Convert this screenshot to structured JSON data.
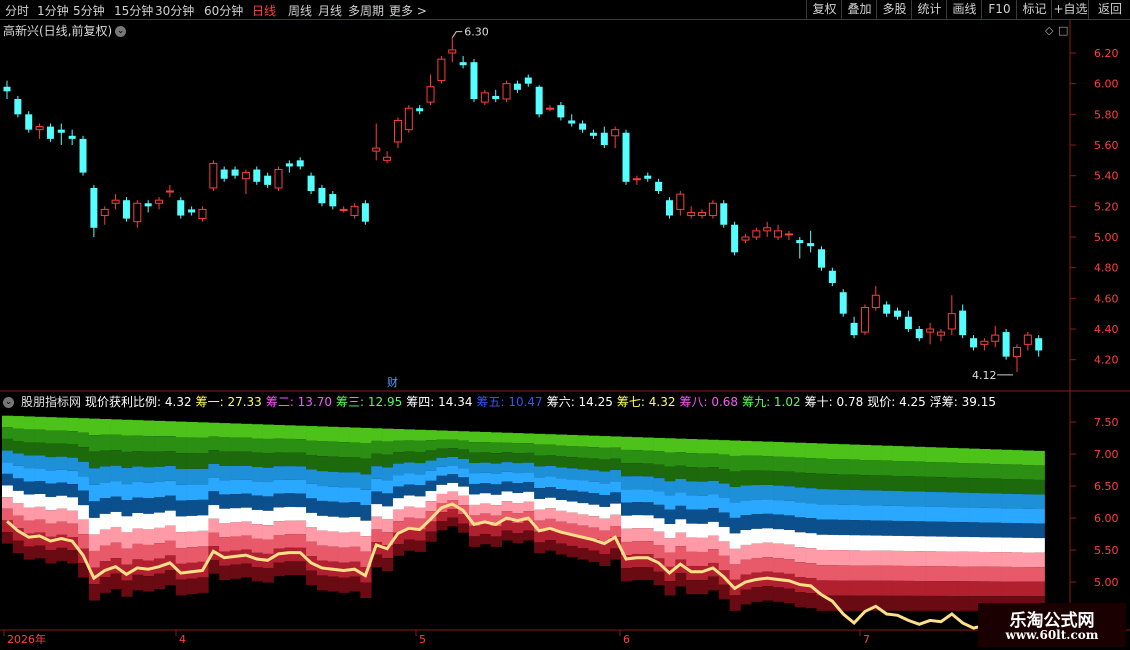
{
  "toolbar": {
    "periods": [
      "分时",
      "1分钟",
      "5分钟",
      "15分钟",
      "30分钟",
      "60分钟",
      "日线",
      "周线",
      "月线",
      "多周期",
      "更多 >"
    ],
    "active_period": "日线",
    "actions": [
      "复权",
      "叠加",
      "多股",
      "统计",
      "画线",
      "F10",
      "标记",
      "+自选",
      "返回"
    ]
  },
  "chart": {
    "title": "高新兴(日线,前复权)",
    "high_marker": "6.30",
    "low_marker": "4.12",
    "finance_marker": "财",
    "y_ticks": [
      "6.20",
      "6.00",
      "5.80",
      "5.60",
      "5.40",
      "5.20",
      "5.00",
      "4.80",
      "4.60",
      "4.40",
      "4.20"
    ],
    "up_color": "#ff3c3c",
    "down_color": "#54ffff"
  },
  "indicator": {
    "name": "股朋指标网",
    "fields": [
      {
        "label": "现价获利比例: 4.32",
        "color": "#ffffff"
      },
      {
        "label": "筹一: 27.33",
        "color": "#ffff55"
      },
      {
        "label": "筹二: 13.70",
        "color": "#ff55ff"
      },
      {
        "label": "筹三: 12.95",
        "color": "#55ff55"
      },
      {
        "label": "筹四: 14.34",
        "color": "#ffffff"
      },
      {
        "label": "筹五: 10.47",
        "color": "#3355ff"
      },
      {
        "label": "筹六: 14.25",
        "color": "#ffffff"
      },
      {
        "label": "筹七: 4.32",
        "color": "#ffff55"
      },
      {
        "label": "筹八: 0.68",
        "color": "#ff55ff"
      },
      {
        "label": "筹九: 1.02",
        "color": "#55ff55"
      },
      {
        "label": "筹十: 0.78",
        "color": "#ffffff"
      },
      {
        "label": "现价: 4.25",
        "color": "#ffffff"
      },
      {
        "label": "浮筹: 39.15",
        "color": "#ffffff"
      }
    ],
    "y_ticks": [
      "7.50",
      "7.00",
      "6.50",
      "6.00",
      "5.50",
      "5.00",
      "4.50"
    ]
  },
  "x_axis": {
    "labels": [
      "2026年",
      "4",
      "5",
      "6",
      "7"
    ]
  },
  "watermark": {
    "line1": "乐淘公式网",
    "line2": "www.60lt.com"
  },
  "chart_data": {
    "type": "candlestick",
    "title": "高新兴(日线,前复权)",
    "ylim": [
      4.1,
      6.35
    ],
    "x": [
      "2026年",
      "4",
      "5",
      "6",
      "7"
    ],
    "candles": [
      [
        5.98,
        6.02,
        5.9,
        5.95
      ],
      [
        5.9,
        5.92,
        5.78,
        5.8
      ],
      [
        5.8,
        5.82,
        5.68,
        5.7
      ],
      [
        5.7,
        5.74,
        5.64,
        5.72
      ],
      [
        5.72,
        5.74,
        5.62,
        5.64
      ],
      [
        5.7,
        5.74,
        5.6,
        5.68
      ],
      [
        5.66,
        5.7,
        5.6,
        5.64
      ],
      [
        5.64,
        5.66,
        5.4,
        5.42
      ],
      [
        5.32,
        5.34,
        5.0,
        5.06
      ],
      [
        5.14,
        5.2,
        5.08,
        5.18
      ],
      [
        5.22,
        5.28,
        5.18,
        5.24
      ],
      [
        5.24,
        5.26,
        5.1,
        5.12
      ],
      [
        5.1,
        5.24,
        5.06,
        5.22
      ],
      [
        5.22,
        5.24,
        5.16,
        5.2
      ],
      [
        5.22,
        5.26,
        5.18,
        5.24
      ],
      [
        5.3,
        5.34,
        5.26,
        5.3
      ],
      [
        5.24,
        5.26,
        5.12,
        5.14
      ],
      [
        5.18,
        5.2,
        5.14,
        5.16
      ],
      [
        5.12,
        5.2,
        5.1,
        5.18
      ],
      [
        5.32,
        5.5,
        5.3,
        5.48
      ],
      [
        5.44,
        5.46,
        5.36,
        5.38
      ],
      [
        5.44,
        5.46,
        5.38,
        5.4
      ],
      [
        5.38,
        5.44,
        5.28,
        5.42
      ],
      [
        5.44,
        5.46,
        5.34,
        5.36
      ],
      [
        5.4,
        5.42,
        5.32,
        5.34
      ],
      [
        5.32,
        5.46,
        5.3,
        5.44
      ],
      [
        5.48,
        5.5,
        5.42,
        5.46
      ],
      [
        5.5,
        5.52,
        5.44,
        5.46
      ],
      [
        5.4,
        5.42,
        5.28,
        5.3
      ],
      [
        5.32,
        5.34,
        5.2,
        5.22
      ],
      [
        5.28,
        5.3,
        5.18,
        5.2
      ],
      [
        5.18,
        5.2,
        5.16,
        5.18
      ],
      [
        5.14,
        5.22,
        5.12,
        5.2
      ],
      [
        5.22,
        5.24,
        5.08,
        5.1
      ],
      [
        5.56,
        5.74,
        5.5,
        5.58
      ],
      [
        5.5,
        5.56,
        5.48,
        5.52
      ],
      [
        5.62,
        5.78,
        5.58,
        5.76
      ],
      [
        5.7,
        5.86,
        5.68,
        5.84
      ],
      [
        5.84,
        5.86,
        5.8,
        5.82
      ],
      [
        5.88,
        6.06,
        5.86,
        5.98
      ],
      [
        6.02,
        6.18,
        6.0,
        6.16
      ],
      [
        6.2,
        6.3,
        6.14,
        6.22
      ],
      [
        6.14,
        6.18,
        6.1,
        6.12
      ],
      [
        6.14,
        6.16,
        5.88,
        5.9
      ],
      [
        5.88,
        5.96,
        5.86,
        5.94
      ],
      [
        5.92,
        5.96,
        5.88,
        5.9
      ],
      [
        5.9,
        6.02,
        5.88,
        6.0
      ],
      [
        6.0,
        6.02,
        5.94,
        5.96
      ],
      [
        6.04,
        6.06,
        5.98,
        6.0
      ],
      [
        5.98,
        5.99,
        5.78,
        5.8
      ],
      [
        5.84,
        5.86,
        5.82,
        5.84
      ],
      [
        5.86,
        5.88,
        5.76,
        5.78
      ],
      [
        5.76,
        5.8,
        5.72,
        5.74
      ],
      [
        5.74,
        5.76,
        5.68,
        5.7
      ],
      [
        5.68,
        5.7,
        5.64,
        5.66
      ],
      [
        5.68,
        5.72,
        5.58,
        5.6
      ],
      [
        5.66,
        5.72,
        5.58,
        5.7
      ],
      [
        5.68,
        5.7,
        5.34,
        5.36
      ],
      [
        5.38,
        5.4,
        5.34,
        5.38
      ],
      [
        5.4,
        5.42,
        5.36,
        5.38
      ],
      [
        5.36,
        5.38,
        5.28,
        5.3
      ],
      [
        5.24,
        5.26,
        5.12,
        5.14
      ],
      [
        5.18,
        5.3,
        5.14,
        5.28
      ],
      [
        5.14,
        5.2,
        5.12,
        5.16
      ],
      [
        5.14,
        5.18,
        5.12,
        5.16
      ],
      [
        5.14,
        5.24,
        5.12,
        5.22
      ],
      [
        5.22,
        5.24,
        5.06,
        5.08
      ],
      [
        5.08,
        5.1,
        4.88,
        4.9
      ],
      [
        4.98,
        5.02,
        4.96,
        5.0
      ],
      [
        5.0,
        5.06,
        4.98,
        5.04
      ],
      [
        5.04,
        5.1,
        5.0,
        5.06
      ],
      [
        5.0,
        5.08,
        4.98,
        5.04
      ],
      [
        5.02,
        5.04,
        4.98,
        5.02
      ],
      [
        4.98,
        5.0,
        4.86,
        4.96
      ],
      [
        4.96,
        5.04,
        4.9,
        4.94
      ],
      [
        4.92,
        4.94,
        4.78,
        4.8
      ],
      [
        4.78,
        4.8,
        4.68,
        4.7
      ],
      [
        4.64,
        4.66,
        4.48,
        4.5
      ],
      [
        4.44,
        4.48,
        4.34,
        4.36
      ],
      [
        4.38,
        4.56,
        4.36,
        4.54
      ],
      [
        4.54,
        4.68,
        4.52,
        4.62
      ],
      [
        4.56,
        4.58,
        4.48,
        4.5
      ],
      [
        4.52,
        4.54,
        4.46,
        4.48
      ],
      [
        4.48,
        4.52,
        4.38,
        4.4
      ],
      [
        4.4,
        4.42,
        4.32,
        4.34
      ],
      [
        4.38,
        4.44,
        4.3,
        4.4
      ],
      [
        4.36,
        4.4,
        4.32,
        4.38
      ],
      [
        4.4,
        4.62,
        4.36,
        4.5
      ],
      [
        4.52,
        4.56,
        4.34,
        4.36
      ],
      [
        4.34,
        4.36,
        4.26,
        4.28
      ],
      [
        4.3,
        4.34,
        4.26,
        4.32
      ],
      [
        4.32,
        4.42,
        4.28,
        4.36
      ],
      [
        4.38,
        4.4,
        4.2,
        4.22
      ],
      [
        4.22,
        4.3,
        4.12,
        4.28
      ],
      [
        4.3,
        4.38,
        4.26,
        4.36
      ],
      [
        4.34,
        4.36,
        4.22,
        4.26
      ]
    ]
  }
}
